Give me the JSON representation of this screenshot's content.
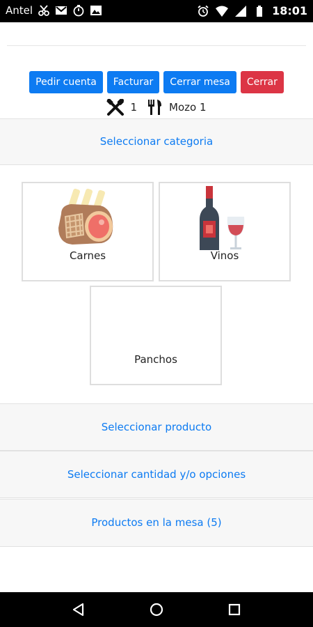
{
  "status_bar": {
    "carrier": "Antel",
    "time": "18:01",
    "icons": [
      "scissors-icon",
      "gmail-icon",
      "stopwatch-icon",
      "image-icon",
      "alarm-icon",
      "wifi-icon",
      "signal-icon",
      "battery-icon"
    ]
  },
  "actions": {
    "pedir_cuenta": "Pedir cuenta",
    "facturar": "Facturar",
    "cerrar_mesa": "Cerrar mesa",
    "cerrar": "Cerrar"
  },
  "table_info": {
    "table_number": "1",
    "waiter": "Mozo 1"
  },
  "sections": {
    "categoria": "Seleccionar categoria",
    "producto": "Seleccionar producto",
    "cantidad": "Seleccionar cantidad y/o opciones",
    "productos_mesa": "Productos en la mesa (5)"
  },
  "categories": [
    {
      "label": "Carnes",
      "icon": "meat-icon"
    },
    {
      "label": "Vinos",
      "icon": "wine-icon"
    },
    {
      "label": "Panchos",
      "icon": ""
    }
  ],
  "colors": {
    "primary": "#0d7bf2",
    "danger": "#dc3545",
    "link": "#0d7bf2"
  }
}
